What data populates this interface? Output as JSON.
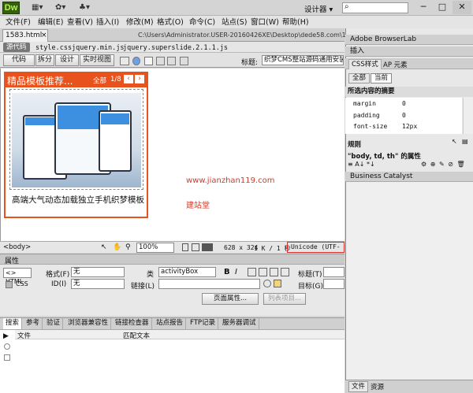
{
  "app": {
    "logo": "Dw",
    "workspace": "设计器 ▾",
    "win_min": "─",
    "win_max": "□",
    "win_close": "✕"
  },
  "toolbar_icons": [
    "▦▾",
    "✿▾",
    "♣▾"
  ],
  "menu": [
    "文件(F)",
    "编辑(E)",
    "查看(V)",
    "插入(I)",
    "修改(M)",
    "格式(O)",
    "命令(C)",
    "站点(S)",
    "窗口(W)",
    "帮助(H)"
  ],
  "doc": {
    "tab": "1583.html",
    "tab_close": "×",
    "source_btn": "源代码",
    "related_files": [
      "style.css",
      "jquery.min.js",
      "jquery.superslide.2.1.1.js"
    ],
    "path": "C:\\Users\\Administrator.USER-20160426XE\\Desktop\\dede58.com\\1583.html",
    "filter_icon": "⊻"
  },
  "views": {
    "code": "代码",
    "split": "拆分",
    "design": "设计",
    "live": "实时视图",
    "title_label": "标题:",
    "title_value": "织梦CMS整站源码通用安装教"
  },
  "widget": {
    "title": "精品模板推荐...",
    "tab_all": "全部",
    "counter": "1/8",
    "prev": "‹",
    "next": "›",
    "caption": "高端大气动态加载独立手机织梦模板"
  },
  "watermark": {
    "url": "www.jianzhan119.com",
    "name": "建站堂"
  },
  "status": {
    "tag": "<body>",
    "zoom": "100%",
    "size": "628 x 324",
    "kb": "1 K / 1 秒",
    "encoding": "Unicode (UTF-8)"
  },
  "properties": {
    "header": "属性",
    "html_btn": "<> HTML",
    "css_btn": "CSS",
    "format_label": "格式(F)",
    "format_value": "无",
    "id_label": "ID(I)",
    "id_value": "无",
    "class_label": "类",
    "class_value": "activityBox",
    "bold": "B",
    "italic": "I",
    "link_label": "链接(L)",
    "title_label": "标题(T)",
    "target_label": "目标(G)",
    "page_props_btn": "页面属性...",
    "list_item_btn": "列表项目..."
  },
  "bottom_tabs": [
    "搜索",
    "参考",
    "验证",
    "浏览器兼容性",
    "链接检查器",
    "站点报告",
    "FTP记录",
    "服务器调试"
  ],
  "results": {
    "col_file": "文件",
    "col_match": "匹配文本"
  },
  "right": {
    "browserlab": "Adobe BrowserLab",
    "insert": "插入",
    "tab_css": "CSS样式",
    "tab_ap": "AP 元素",
    "btn_all": "全部",
    "btn_current": "当前",
    "summary_title": "所选内容的摘要",
    "css_props": [
      {
        "name": "margin",
        "value": "0"
      },
      {
        "name": "padding",
        "value": "0"
      },
      {
        "name": "font-size",
        "value": "12px"
      }
    ],
    "rules": "规则",
    "rule_props_title": "\"body, td, th\" 的属性",
    "catalyst": "Business Catalyst",
    "bottom_tab_files": "文件",
    "bottom_tab_assets": "资源"
  },
  "colors": {
    "accent": "#e8521c",
    "watermark": "#d23a2a",
    "status_highlight": "#d93030"
  }
}
